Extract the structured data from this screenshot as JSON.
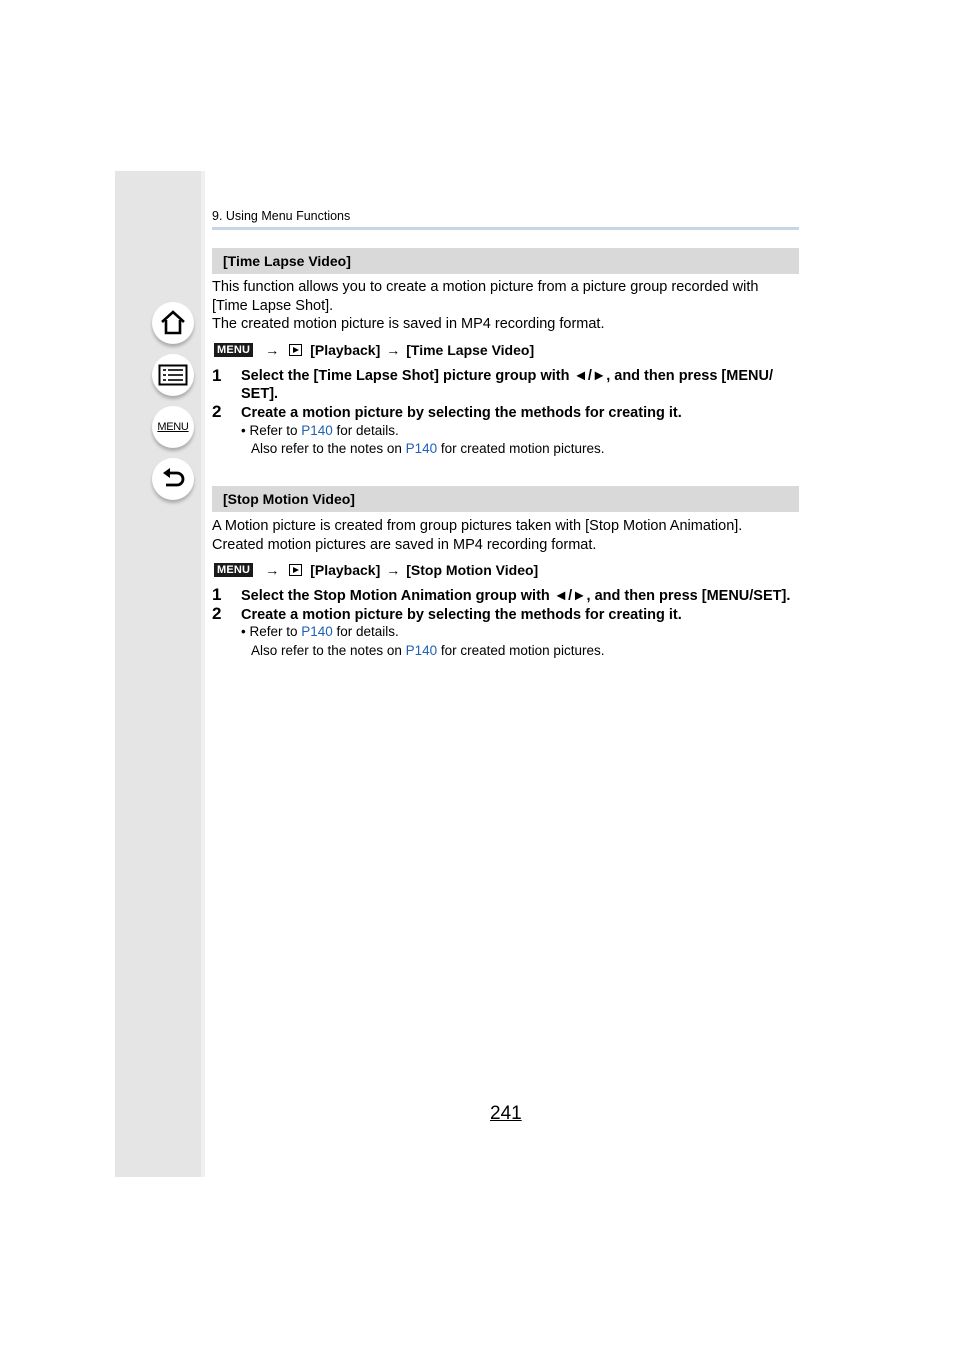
{
  "header": {
    "breadcrumb": "9. Using Menu Functions"
  },
  "nav": {
    "home_icon": "home-icon",
    "contents_icon": "contents-list-icon",
    "menu_label": "MENU",
    "back_icon": "back-arrow-icon"
  },
  "section1": {
    "title": "[Time Lapse Video]",
    "intro_line1": "This function allows you to create a motion picture from a picture group recorded with",
    "intro_line2": "[Time Lapse Shot].",
    "intro_line3": "The created motion picture is saved in MP4 recording format.",
    "menu_badge": "MENU",
    "arrow1": "→",
    "path_playback": "[Playback]",
    "arrow2": "→",
    "path_item": "[Time Lapse Video]",
    "step1_num": "1",
    "step1_line1": "Select the [Time Lapse Shot] picture group with ◄/►, and then press [MENU/",
    "step1_line2": "SET].",
    "step2_num": "2",
    "step2_text": "Create a motion picture by selecting the methods for creating it.",
    "note1_pre": "• Refer to ",
    "note1_link": "P140",
    "note1_post": " for details.",
    "note2_pre": "Also refer to the notes on ",
    "note2_link": "P140",
    "note2_post": " for created motion pictures."
  },
  "section2": {
    "title": "[Stop Motion Video]",
    "intro_line1": "A Motion picture is created from group pictures taken with [Stop Motion Animation].",
    "intro_line2": "Created motion pictures are saved in MP4 recording format.",
    "menu_badge": "MENU",
    "arrow1": "→",
    "path_playback": "[Playback]",
    "arrow2": "→",
    "path_item": "[Stop Motion Video]",
    "step1_num": "1",
    "step1_text": "Select the Stop Motion Animation group with ◄/►, and then press [MENU/SET].",
    "step2_num": "2",
    "step2_text": "Create a motion picture by selecting the methods for creating it.",
    "note1_pre": "• Refer to ",
    "note1_link": "P140",
    "note1_post": " for details.",
    "note2_pre": "Also refer to the notes on ",
    "note2_link": "P140",
    "note2_post": " for created motion pictures."
  },
  "footer": {
    "page_number": "241"
  }
}
